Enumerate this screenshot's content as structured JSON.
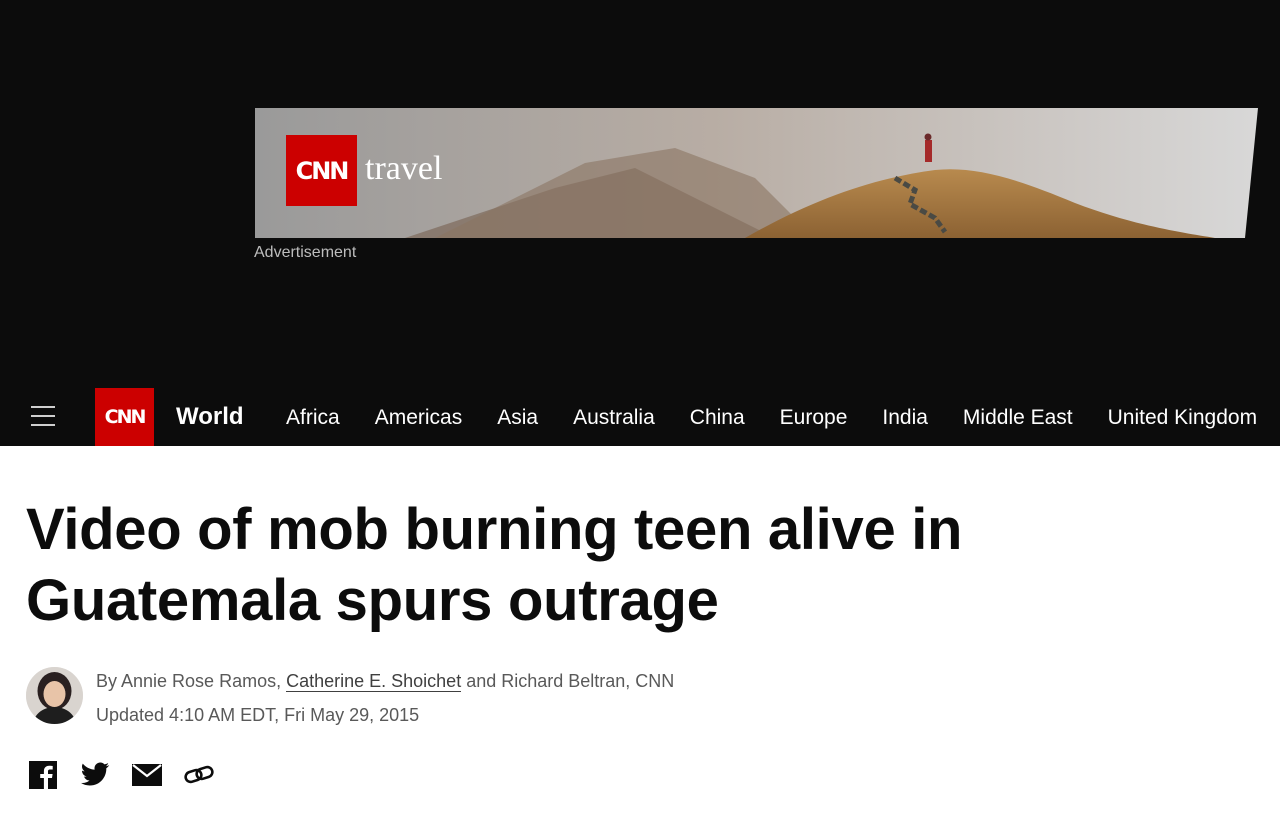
{
  "ad": {
    "brand_logo_text": "CNN",
    "brand_word": "travel",
    "label": "Advertisement"
  },
  "nav": {
    "logo_text": "CNN",
    "section": "World",
    "links": [
      "Africa",
      "Americas",
      "Asia",
      "Australia",
      "China",
      "Europe",
      "India",
      "Middle East",
      "United Kingdom"
    ]
  },
  "article": {
    "headline": "Video of mob burning teen alive in Guatemala spurs outrage",
    "byline_prefix": "By Annie Rose Ramos, ",
    "byline_link": "Catherine E. Shoichet",
    "byline_suffix": " and Richard Beltran, CNN",
    "updated": "Updated 4:10 AM EDT, Fri May 29, 2015"
  },
  "share_icons": [
    "facebook-icon",
    "twitter-icon",
    "email-icon",
    "link-icon"
  ],
  "colors": {
    "brand_red": "#cc0000",
    "nav_bg": "#0c0c0c",
    "text": "#0c0c0c",
    "meta_text": "#595959"
  }
}
